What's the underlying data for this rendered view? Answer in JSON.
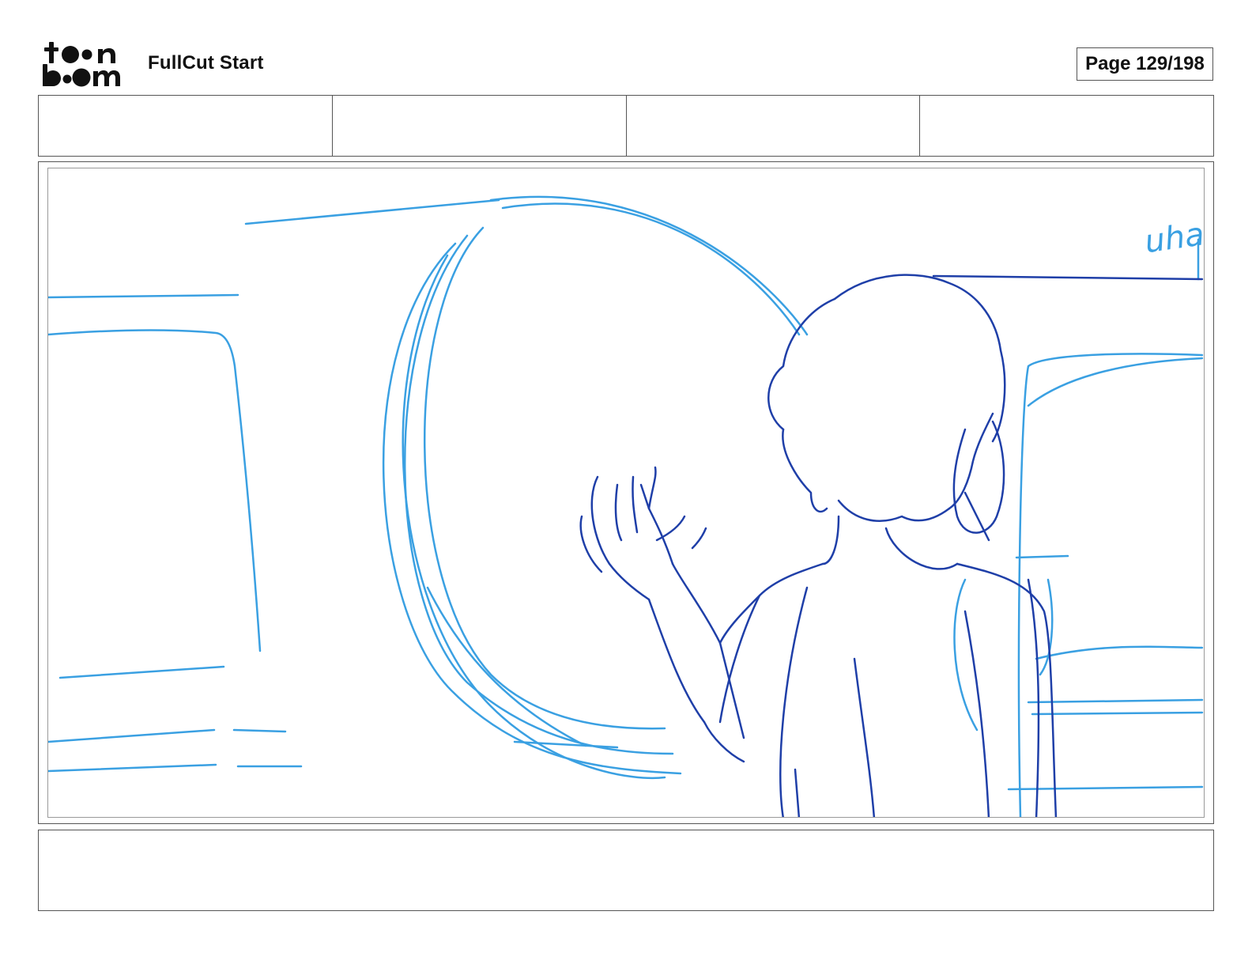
{
  "header": {
    "logo_text": "toon boom",
    "project_title": "FullCut Start",
    "page_label": "Page 129/198"
  },
  "info_row": {
    "cells": [
      "",
      "",
      "",
      ""
    ]
  },
  "panel": {
    "sketch_text": "uha",
    "colors": {
      "light_line": "#3aa0e2",
      "dark_line": "#1f3fa8",
      "frame": "#555555"
    }
  },
  "notes": {
    "text": ""
  }
}
